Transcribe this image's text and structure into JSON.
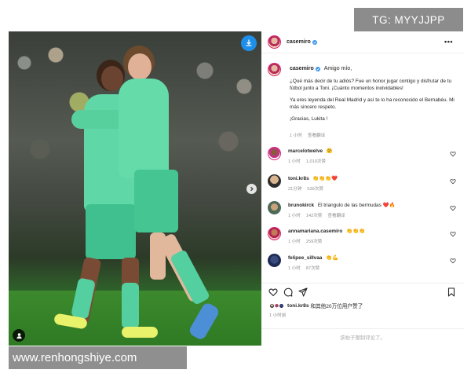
{
  "watermarks": {
    "top": "TG: MYYJJPP",
    "bottom": "www.renhongshiye.com"
  },
  "post": {
    "author": "casemiro",
    "verified": true,
    "more_icon": "more-horizontal-icon",
    "media": {
      "download_icon": "download-icon",
      "tag_icon": "user-tag-icon",
      "next_icon": "chevron-right-icon",
      "description_colors": {
        "kit": "#5fd7a6",
        "pitch": "#2f7a24"
      }
    },
    "caption": {
      "author": "casemiro",
      "paragraphs": [
        "Amigo mío,",
        "¿Qué más decir de tu adiós? Fue un honor jugar contigo y disfrutar de tu fútbol junto a Toni. ¡Cuánto momentos inolvidables!",
        "Ya eres leyenda del Real Madrid y así te lo ha reconocido el Bernabéu. Mi más sincero respeto.",
        "¡Gracias, Lukita !"
      ],
      "time": "1 小时",
      "translate": "查看翻译"
    },
    "comments": [
      {
        "user": "marcelotwelve",
        "verified": true,
        "text": "🤗",
        "time": "1 小时",
        "likes": "1,010次赞",
        "reply": "",
        "heart_icon": "heart-outline-icon"
      },
      {
        "user": "toni.kr8s",
        "verified": true,
        "text": "👏👏👏❤️",
        "time": "21分钟",
        "likes": "539次赞",
        "reply": "",
        "heart_icon": "heart-outline-icon"
      },
      {
        "user": "brunokirck",
        "verified": false,
        "text": "El triangulo de las bermudas ❤️🔥",
        "time": "1 小时",
        "likes": "142次赞",
        "reply": "查看翻译",
        "heart_icon": "heart-outline-icon"
      },
      {
        "user": "annamariana.casemiro",
        "verified": true,
        "text": "👏👏👏",
        "time": "1 小时",
        "likes": "259次赞",
        "reply": "",
        "heart_icon": "heart-outline-icon"
      },
      {
        "user": "felipee_sillvaa",
        "verified": false,
        "text": "👏💪",
        "time": "1 小时",
        "likes": "87次赞",
        "reply": "",
        "heart_icon": "heart-outline-icon"
      }
    ],
    "actions": {
      "like_icon": "heart-outline-icon",
      "comment_icon": "comment-icon",
      "share_icon": "share-icon",
      "save_icon": "bookmark-icon"
    },
    "likes_summary": {
      "user": "toni.kr8s",
      "rest": "和其他20万位用户赞了"
    },
    "post_time": "1 小时前",
    "comment_placeholder": "该帖子限制评论了。"
  }
}
